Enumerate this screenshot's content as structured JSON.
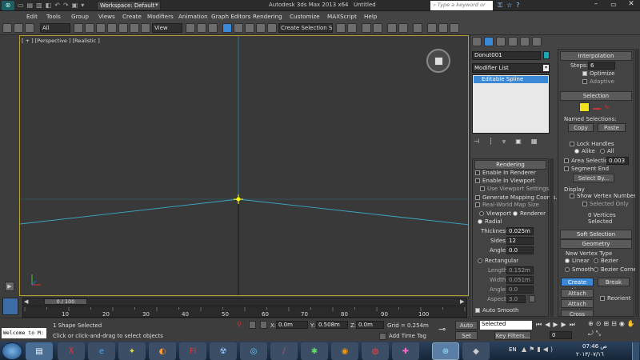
{
  "title": {
    "workspace": "Workspace: Default",
    "app": "Autodesk 3ds Max  2013 x64",
    "doc": "Untitled",
    "search_placeholder": "Type a keyword or phrase"
  },
  "menu": [
    "Edit",
    "Tools",
    "Group",
    "Views",
    "Create",
    "Modifiers",
    "Animation",
    "Graph Editors",
    "Rendering",
    "Customize",
    "MAXScript",
    "Help"
  ],
  "toolbar": {
    "filter": "All",
    "refcoord": "View",
    "selset": "Create Selection Se"
  },
  "viewport": {
    "label": "[ + ] [Perspective ] [Realistic ]"
  },
  "panel": {
    "object_name": "Donut001",
    "modifier_list": "Modifier List",
    "stack_item": "Editable Spline",
    "rendering": {
      "title": "Rendering",
      "enable_renderer": "Enable In Renderer",
      "enable_viewport": "Enable In Viewport",
      "use_viewport": "Use Viewport Settings",
      "gen_mapping": "Generate Mapping Coords.",
      "real_world": "Real-World Map Size",
      "viewport": "Viewport",
      "renderer": "Renderer",
      "radial": "Radial",
      "thickness_label": "Thickness:",
      "thickness": "0.025m",
      "sides_label": "Sides:",
      "sides": "12",
      "angle_label": "Angle:",
      "angle": "0.0",
      "rectangular": "Rectangular",
      "length_label": "Length:",
      "length": "0.152m",
      "width_label": "Width:",
      "width": "0.051m",
      "angle2_label": "Angle:",
      "angle2": "0.0",
      "aspect_label": "Aspect:",
      "aspect": "3.0",
      "auto_smooth": "Auto Smooth"
    },
    "interp": {
      "title": "Interpolation",
      "steps_label": "Steps:",
      "steps": "6",
      "optimize": "Optimize",
      "adaptive": "Adaptive"
    },
    "selection": {
      "title": "Selection",
      "named": "Named Selections:",
      "copy": "Copy",
      "paste": "Paste",
      "lock_handles": "Lock Handles",
      "alike": "Alike",
      "all": "All",
      "area_sel": "Area Selection:",
      "area_val": "0.003",
      "segment_end": "Segment End",
      "select_by": "Select By...",
      "display": "Display",
      "show_vertex": "Show Vertex Numbers",
      "selected_only": "Selected Only",
      "status": "0 Vertices Selected"
    },
    "soft_selection": "Soft Selection",
    "geometry": {
      "title": "Geometry",
      "new_vertex": "New Vertex Type",
      "linear": "Linear",
      "bezier": "Bezier",
      "smooth": "Smooth",
      "bezier_corner": "Bezier Corner",
      "create_line": "Create Line",
      "break": "Break",
      "attach": "Attach",
      "reorient": "Reorient",
      "attach_mult": "Attach Mult.",
      "cross_section": "Cross Section"
    }
  },
  "timeline": {
    "slider": "0 / 100",
    "ticks": [
      "0",
      "10",
      "20",
      "30",
      "40",
      "50",
      "60",
      "70",
      "80",
      "90",
      "100"
    ]
  },
  "status": {
    "listener": "Welcome to M:",
    "selected": "1 Shape Selected",
    "prompt": "Click or click-and-drag to select objects",
    "x_label": "X:",
    "x": "0.0m",
    "y_label": "Y:",
    "y": "0.508m",
    "z_label": "Z:",
    "z": "0.0m",
    "grid": "Grid = 0.254m",
    "add_time_tag": "Add Time Tag",
    "auto_key": "Auto Key",
    "set_key": "Set Key",
    "key_sel": "Selected",
    "key_filters": "Key Filters...",
    "frame": "0"
  },
  "taskbar": {
    "lang": "EN",
    "time": "07:46 ص",
    "date": "٢٠١٣/٠٧/١٦"
  },
  "colors": {
    "accent": "#3b89d6",
    "viewport": "#3a3a3a",
    "spline": "#3aa8c8",
    "gizmo": "#ffff00",
    "taskbar": "#1c2f47"
  }
}
